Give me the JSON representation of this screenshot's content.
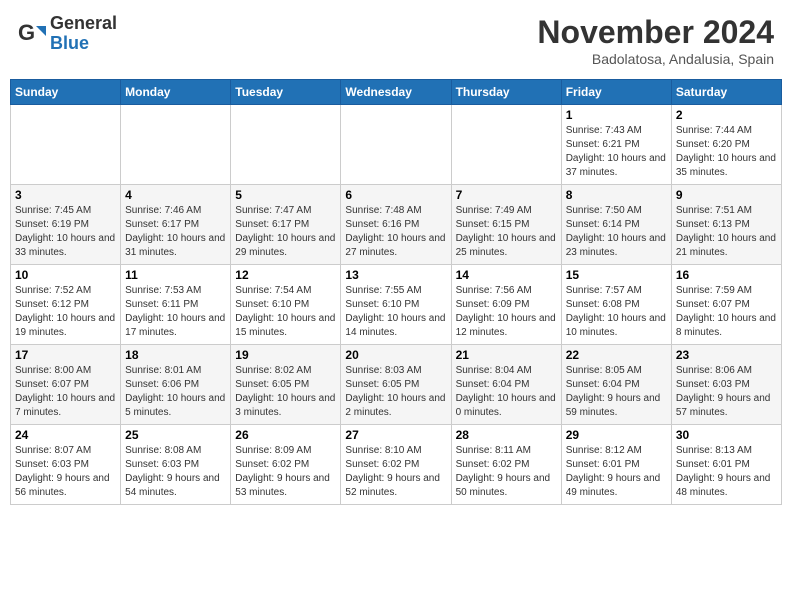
{
  "header": {
    "logo_general": "General",
    "logo_blue": "Blue",
    "month_title": "November 2024",
    "location": "Badolatosa, Andalusia, Spain"
  },
  "calendar": {
    "days_of_week": [
      "Sunday",
      "Monday",
      "Tuesday",
      "Wednesday",
      "Thursday",
      "Friday",
      "Saturday"
    ],
    "weeks": [
      [
        {
          "day": "",
          "info": ""
        },
        {
          "day": "",
          "info": ""
        },
        {
          "day": "",
          "info": ""
        },
        {
          "day": "",
          "info": ""
        },
        {
          "day": "",
          "info": ""
        },
        {
          "day": "1",
          "info": "Sunrise: 7:43 AM\nSunset: 6:21 PM\nDaylight: 10 hours and 37 minutes."
        },
        {
          "day": "2",
          "info": "Sunrise: 7:44 AM\nSunset: 6:20 PM\nDaylight: 10 hours and 35 minutes."
        }
      ],
      [
        {
          "day": "3",
          "info": "Sunrise: 7:45 AM\nSunset: 6:19 PM\nDaylight: 10 hours and 33 minutes."
        },
        {
          "day": "4",
          "info": "Sunrise: 7:46 AM\nSunset: 6:17 PM\nDaylight: 10 hours and 31 minutes."
        },
        {
          "day": "5",
          "info": "Sunrise: 7:47 AM\nSunset: 6:17 PM\nDaylight: 10 hours and 29 minutes."
        },
        {
          "day": "6",
          "info": "Sunrise: 7:48 AM\nSunset: 6:16 PM\nDaylight: 10 hours and 27 minutes."
        },
        {
          "day": "7",
          "info": "Sunrise: 7:49 AM\nSunset: 6:15 PM\nDaylight: 10 hours and 25 minutes."
        },
        {
          "day": "8",
          "info": "Sunrise: 7:50 AM\nSunset: 6:14 PM\nDaylight: 10 hours and 23 minutes."
        },
        {
          "day": "9",
          "info": "Sunrise: 7:51 AM\nSunset: 6:13 PM\nDaylight: 10 hours and 21 minutes."
        }
      ],
      [
        {
          "day": "10",
          "info": "Sunrise: 7:52 AM\nSunset: 6:12 PM\nDaylight: 10 hours and 19 minutes."
        },
        {
          "day": "11",
          "info": "Sunrise: 7:53 AM\nSunset: 6:11 PM\nDaylight: 10 hours and 17 minutes."
        },
        {
          "day": "12",
          "info": "Sunrise: 7:54 AM\nSunset: 6:10 PM\nDaylight: 10 hours and 15 minutes."
        },
        {
          "day": "13",
          "info": "Sunrise: 7:55 AM\nSunset: 6:10 PM\nDaylight: 10 hours and 14 minutes."
        },
        {
          "day": "14",
          "info": "Sunrise: 7:56 AM\nSunset: 6:09 PM\nDaylight: 10 hours and 12 minutes."
        },
        {
          "day": "15",
          "info": "Sunrise: 7:57 AM\nSunset: 6:08 PM\nDaylight: 10 hours and 10 minutes."
        },
        {
          "day": "16",
          "info": "Sunrise: 7:59 AM\nSunset: 6:07 PM\nDaylight: 10 hours and 8 minutes."
        }
      ],
      [
        {
          "day": "17",
          "info": "Sunrise: 8:00 AM\nSunset: 6:07 PM\nDaylight: 10 hours and 7 minutes."
        },
        {
          "day": "18",
          "info": "Sunrise: 8:01 AM\nSunset: 6:06 PM\nDaylight: 10 hours and 5 minutes."
        },
        {
          "day": "19",
          "info": "Sunrise: 8:02 AM\nSunset: 6:05 PM\nDaylight: 10 hours and 3 minutes."
        },
        {
          "day": "20",
          "info": "Sunrise: 8:03 AM\nSunset: 6:05 PM\nDaylight: 10 hours and 2 minutes."
        },
        {
          "day": "21",
          "info": "Sunrise: 8:04 AM\nSunset: 6:04 PM\nDaylight: 10 hours and 0 minutes."
        },
        {
          "day": "22",
          "info": "Sunrise: 8:05 AM\nSunset: 6:04 PM\nDaylight: 9 hours and 59 minutes."
        },
        {
          "day": "23",
          "info": "Sunrise: 8:06 AM\nSunset: 6:03 PM\nDaylight: 9 hours and 57 minutes."
        }
      ],
      [
        {
          "day": "24",
          "info": "Sunrise: 8:07 AM\nSunset: 6:03 PM\nDaylight: 9 hours and 56 minutes."
        },
        {
          "day": "25",
          "info": "Sunrise: 8:08 AM\nSunset: 6:03 PM\nDaylight: 9 hours and 54 minutes."
        },
        {
          "day": "26",
          "info": "Sunrise: 8:09 AM\nSunset: 6:02 PM\nDaylight: 9 hours and 53 minutes."
        },
        {
          "day": "27",
          "info": "Sunrise: 8:10 AM\nSunset: 6:02 PM\nDaylight: 9 hours and 52 minutes."
        },
        {
          "day": "28",
          "info": "Sunrise: 8:11 AM\nSunset: 6:02 PM\nDaylight: 9 hours and 50 minutes."
        },
        {
          "day": "29",
          "info": "Sunrise: 8:12 AM\nSunset: 6:01 PM\nDaylight: 9 hours and 49 minutes."
        },
        {
          "day": "30",
          "info": "Sunrise: 8:13 AM\nSunset: 6:01 PM\nDaylight: 9 hours and 48 minutes."
        }
      ]
    ]
  }
}
